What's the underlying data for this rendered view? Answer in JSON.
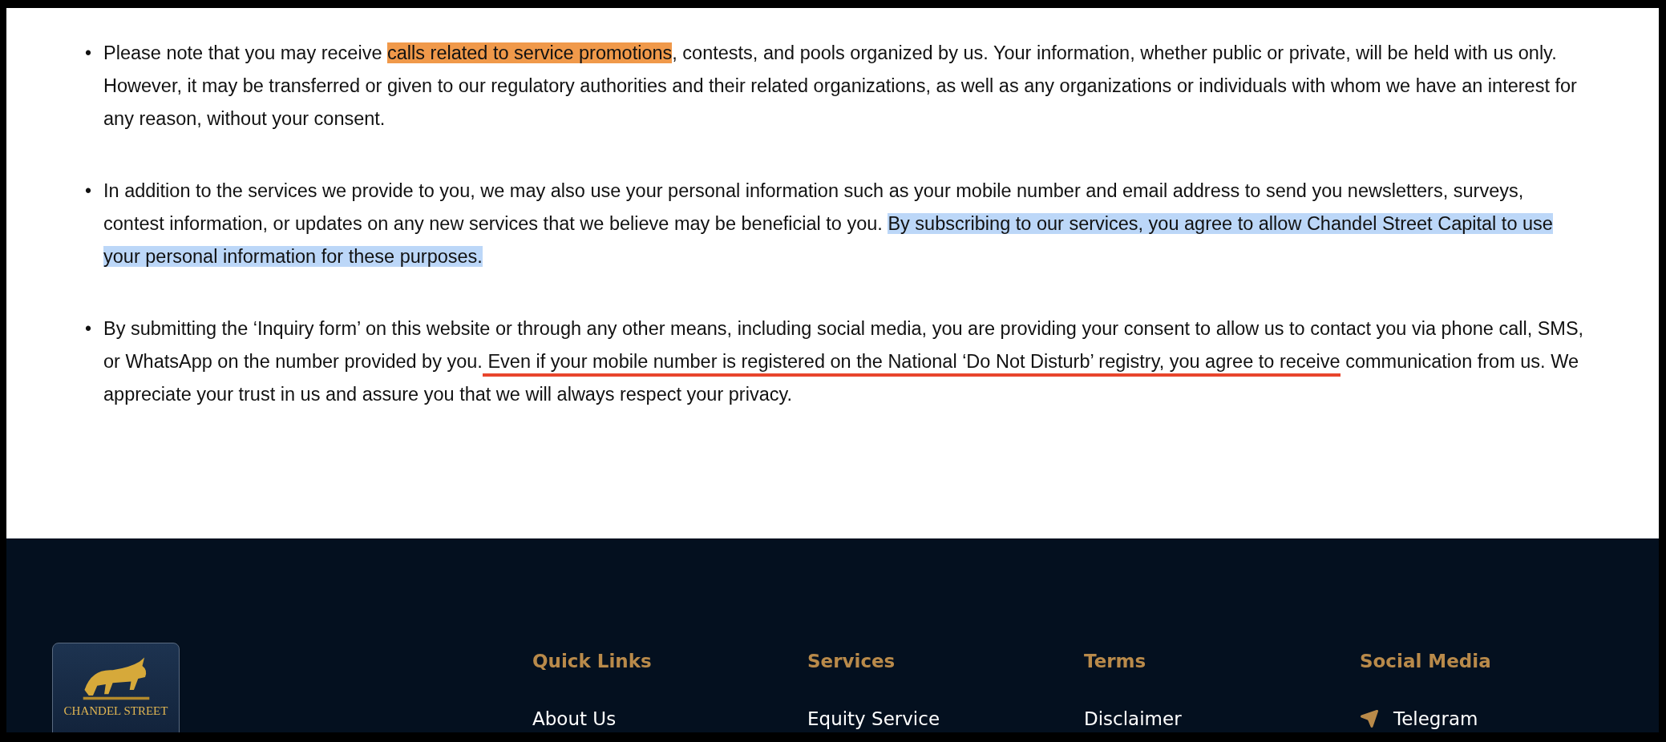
{
  "policy_items": [
    {
      "bullet": "•",
      "segments": [
        {
          "text": "Please note that you may receive ",
          "kind": "plain"
        },
        {
          "text": "calls related to service promotions",
          "kind": "highlighted",
          "color": "#f0994a"
        },
        {
          "text": ", contests, and pools organized by us. Your information, whether public or private, will be held with us only. However, it may be transferred or given to our regulatory authorities and their related organizations, as well as any organizations or individuals with whom we have an interest for any reason, without your consent.",
          "kind": "plain"
        }
      ]
    },
    {
      "bullet": "•",
      "segments": [
        {
          "text": "In addition to the services we provide to you, we may also use your personal information such as your mobile number and email address to send you newsletters, surveys, contest information, or updates on any new services that we believe may be beneficial to you. ",
          "kind": "plain"
        },
        {
          "text": "By subscribing to our services, you agree to allow Chandel Street Capital to use your personal information for these purposes.",
          "kind": "highlighted",
          "color": "#bcd7f8"
        }
      ]
    },
    {
      "bullet": "•",
      "segments": [
        {
          "text": "By submitting the ‘Inquiry form’ on this website or through any other means, including social media, you are providing your consent to allow us to contact you via phone call, SMS, or WhatsApp on the number provided by you.",
          "kind": "plain"
        },
        {
          "text": " Even if your mobile number is registered on the National ‘Do Not Disturb’ registry, you agree to receive",
          "kind": "underlined",
          "color": "#e8452c"
        },
        {
          "text": " communication from us. We appreciate your trust in us and assure you that we will always respect your privacy.",
          "kind": "plain"
        }
      ]
    }
  ],
  "footer": {
    "logo_text": "CHANDEL STREET",
    "columns": [
      {
        "heading": "Quick Links",
        "links": [
          {
            "label": "About Us",
            "kind": "plain"
          }
        ]
      },
      {
        "heading": "Services",
        "links": [
          {
            "label": "Equity Service",
            "kind": "plain"
          }
        ]
      },
      {
        "heading": "Terms",
        "links": [
          {
            "label": "Disclaimer",
            "kind": "plain"
          }
        ]
      },
      {
        "heading": "Social Media",
        "links": [
          {
            "label": "Telegram",
            "kind": "telegram"
          }
        ]
      }
    ]
  }
}
